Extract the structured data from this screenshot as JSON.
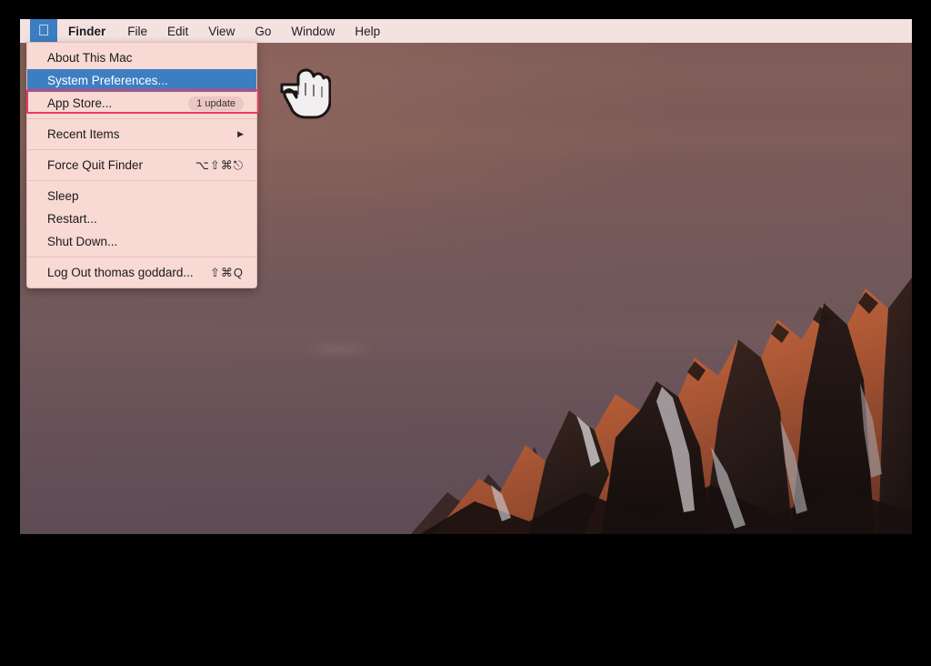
{
  "os": {
    "name": "macOS Sierra desktop",
    "wallpaper": "sierra-mountains-sunset"
  },
  "menubar": {
    "apple_icon": "apple-logo-icon",
    "items": [
      {
        "label": "Finder",
        "bold": true
      },
      {
        "label": "File",
        "bold": false
      },
      {
        "label": "Edit",
        "bold": false
      },
      {
        "label": "View",
        "bold": false
      },
      {
        "label": "Go",
        "bold": false
      },
      {
        "label": "Window",
        "bold": false
      },
      {
        "label": "Help",
        "bold": false
      }
    ]
  },
  "apple_menu": {
    "items": [
      {
        "label": "About This Mac",
        "shortcut": "",
        "badge": "",
        "arrow": "",
        "selected": false
      },
      {
        "label": "System Preferences...",
        "shortcut": "",
        "badge": "",
        "arrow": "",
        "selected": true
      },
      {
        "label": "App Store...",
        "shortcut": "",
        "badge": "1 update",
        "arrow": "",
        "selected": false
      },
      {
        "label": "Recent Items",
        "shortcut": "",
        "badge": "",
        "arrow": "▶",
        "selected": false
      },
      {
        "label": "Force Quit Finder",
        "shortcut": "⌥⇧⌘⎋",
        "badge": "",
        "arrow": "",
        "selected": false
      },
      {
        "label": "Sleep",
        "shortcut": "",
        "badge": "",
        "arrow": "",
        "selected": false
      },
      {
        "label": "Restart...",
        "shortcut": "",
        "badge": "",
        "arrow": "",
        "selected": false
      },
      {
        "label": "Shut Down...",
        "shortcut": "",
        "badge": "",
        "arrow": "",
        "selected": false
      },
      {
        "label": "Log Out thomas goddard...",
        "shortcut": "⇧⌘Q",
        "badge": "",
        "arrow": "",
        "selected": false
      }
    ]
  },
  "annotation": {
    "type": "highlight-rectangle",
    "target": "System Preferences...",
    "color": "#e8395f"
  },
  "cursor": {
    "type": "pointing-hand-cursor",
    "direction": "left"
  },
  "colors": {
    "menubar_bg": "#f4e2e1",
    "menu_bg": "#f8d9d4",
    "selection_blue": "#3d7ec2",
    "annotation_red": "#e8395f",
    "letterbox": "#000000"
  }
}
